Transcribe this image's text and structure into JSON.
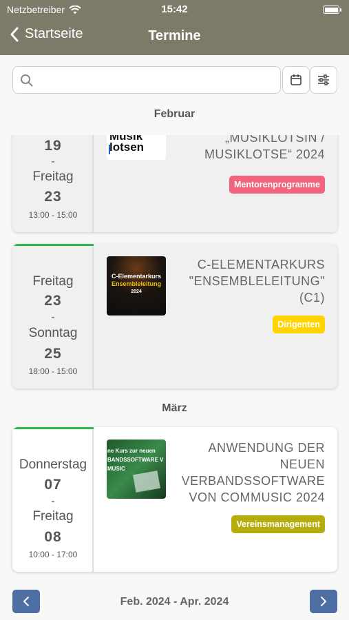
{
  "status_bar": {
    "carrier": "Netzbetreiber",
    "time": "15:42"
  },
  "nav": {
    "back_label": "Startseite",
    "title": "Termine"
  },
  "search": {
    "placeholder": ""
  },
  "months": {
    "first": "Februar",
    "second": "März"
  },
  "events": [
    {
      "date_start_word": "",
      "date_start_num": "19",
      "date_end_word": "Freitag",
      "date_end_num": "23",
      "time": "13:00 - 15:00",
      "thumb_text_1": "Musik",
      "thumb_text_2": "lotsen",
      "title_line_1": "„MUSIKLOTSIN /",
      "title_line_2": "MUSIKLOTSE“ 2024",
      "badge": "Mentorenprogramme",
      "badge_color": "#f0647e"
    },
    {
      "date_start_word": "Freitag",
      "date_start_num": "23",
      "date_end_word": "Sonntag",
      "date_end_num": "25",
      "time": "18:00 - 15:00",
      "thumb_text_1": "C-Elementarkurs",
      "thumb_text_2": "Ensembleleitung",
      "thumb_text_3": "2024",
      "title_line_1": "C-ELEMENTARKURS",
      "title_line_2": "\"ENSEMBLELEITUNG\"",
      "title_line_3": "(C1)",
      "badge": "Dirigenten",
      "badge_color": "#ffd400",
      "accent_color": "#2fb84d"
    },
    {
      "date_start_word": "Donnerstag",
      "date_start_num": "07",
      "date_end_word": "Freitag",
      "date_end_num": "08",
      "time": "10:00 - 17:00",
      "thumb_text_1": "ne Kurs  zur neuen",
      "thumb_text_2": "BANDSSOFTWARE V",
      "thumb_text_3": "MUSIC",
      "title_line_1": "ANWENDUNG DER",
      "title_line_2": "NEUEN",
      "title_line_3": "VERBANDSSOFTWARE",
      "title_line_4": "VON COMMUSIC 2024",
      "badge": "Vereinsmanagement",
      "badge_color": "#b5ad0e",
      "accent_color": "#2fb84d"
    }
  ],
  "dash": "-",
  "pager": {
    "label": "Feb. 2024 - Apr. 2024"
  }
}
